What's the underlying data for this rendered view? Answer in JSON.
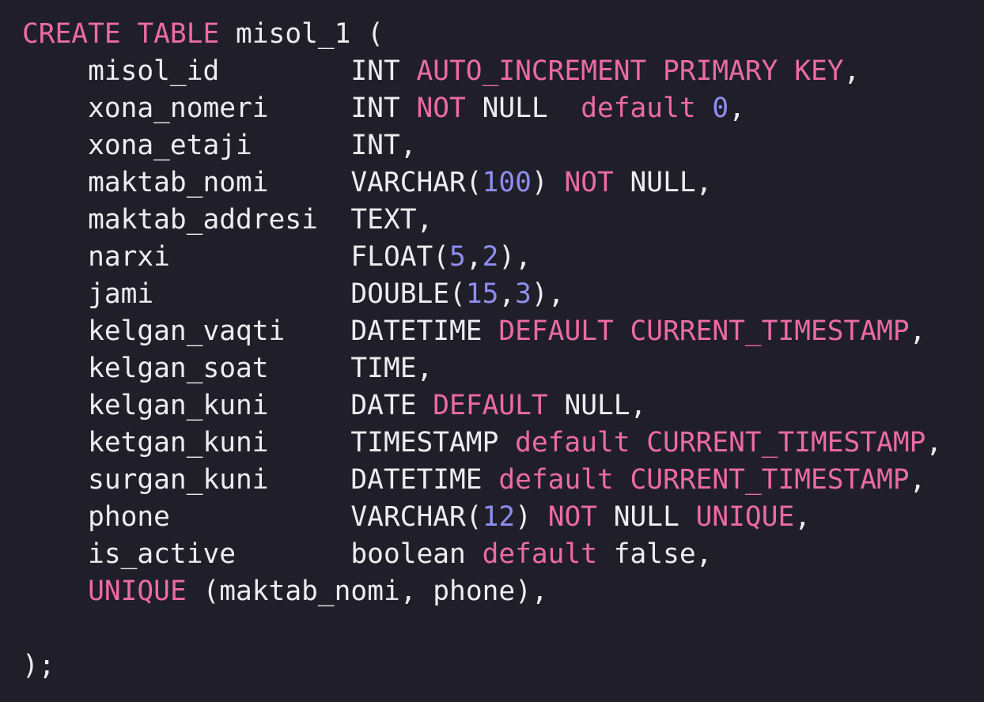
{
  "colors": {
    "background": "#201f29",
    "text": "#ececf1",
    "keyword": "#ec6aa6",
    "number": "#8f8df0"
  },
  "lines": [
    {
      "tokens": [
        {
          "t": "CREATE TABLE",
          "k": "kw"
        },
        {
          "t": " misol_1 (",
          "k": "pl"
        }
      ]
    },
    {
      "tokens": [
        {
          "t": "    misol_id        INT ",
          "k": "pl"
        },
        {
          "t": "AUTO_INCREMENT PRIMARY KEY",
          "k": "kw"
        },
        {
          "t": ",",
          "k": "pl"
        }
      ]
    },
    {
      "tokens": [
        {
          "t": "    xona_nomeri     INT ",
          "k": "pl"
        },
        {
          "t": "NOT",
          "k": "kw"
        },
        {
          "t": " NULL  ",
          "k": "pl"
        },
        {
          "t": "default",
          "k": "kw"
        },
        {
          "t": " ",
          "k": "pl"
        },
        {
          "t": "0",
          "k": "num"
        },
        {
          "t": ",",
          "k": "pl"
        }
      ]
    },
    {
      "tokens": [
        {
          "t": "    xona_etaji      INT,",
          "k": "pl"
        }
      ]
    },
    {
      "tokens": [
        {
          "t": "    maktab_nomi     VARCHAR(",
          "k": "pl"
        },
        {
          "t": "100",
          "k": "num"
        },
        {
          "t": ") ",
          "k": "pl"
        },
        {
          "t": "NOT",
          "k": "kw"
        },
        {
          "t": " NULL,",
          "k": "pl"
        }
      ]
    },
    {
      "tokens": [
        {
          "t": "    maktab_addresi  TEXT,",
          "k": "pl"
        }
      ]
    },
    {
      "tokens": [
        {
          "t": "    narxi           FLOAT(",
          "k": "pl"
        },
        {
          "t": "5",
          "k": "num"
        },
        {
          "t": ",",
          "k": "pl"
        },
        {
          "t": "2",
          "k": "num"
        },
        {
          "t": "),",
          "k": "pl"
        }
      ]
    },
    {
      "tokens": [
        {
          "t": "    jami            DOUBLE(",
          "k": "pl"
        },
        {
          "t": "15",
          "k": "num"
        },
        {
          "t": ",",
          "k": "pl"
        },
        {
          "t": "3",
          "k": "num"
        },
        {
          "t": "),",
          "k": "pl"
        }
      ]
    },
    {
      "tokens": [
        {
          "t": "    kelgan_vaqti    DATETIME ",
          "k": "pl"
        },
        {
          "t": "DEFAULT CURRENT_TIMESTAMP",
          "k": "kw"
        },
        {
          "t": ",",
          "k": "pl"
        }
      ]
    },
    {
      "tokens": [
        {
          "t": "    kelgan_soat     TIME,",
          "k": "pl"
        }
      ]
    },
    {
      "tokens": [
        {
          "t": "    kelgan_kuni     DATE ",
          "k": "pl"
        },
        {
          "t": "DEFAULT",
          "k": "kw"
        },
        {
          "t": " NULL,",
          "k": "pl"
        }
      ]
    },
    {
      "tokens": [
        {
          "t": "    ketgan_kuni     TIMESTAMP ",
          "k": "pl"
        },
        {
          "t": "default CURRENT_TIMESTAMP",
          "k": "kw"
        },
        {
          "t": ",",
          "k": "pl"
        }
      ]
    },
    {
      "tokens": [
        {
          "t": "    surgan_kuni     DATETIME ",
          "k": "pl"
        },
        {
          "t": "default CURRENT_TIMESTAMP",
          "k": "kw"
        },
        {
          "t": ",",
          "k": "pl"
        }
      ]
    },
    {
      "tokens": [
        {
          "t": "    phone           VARCHAR(",
          "k": "pl"
        },
        {
          "t": "12",
          "k": "num"
        },
        {
          "t": ") ",
          "k": "pl"
        },
        {
          "t": "NOT",
          "k": "kw"
        },
        {
          "t": " NULL ",
          "k": "pl"
        },
        {
          "t": "UNIQUE",
          "k": "kw"
        },
        {
          "t": ",",
          "k": "pl"
        }
      ]
    },
    {
      "tokens": [
        {
          "t": "    is_active       boolean ",
          "k": "pl"
        },
        {
          "t": "default",
          "k": "kw"
        },
        {
          "t": " false,",
          "k": "pl"
        }
      ]
    },
    {
      "tokens": [
        {
          "t": "    ",
          "k": "pl"
        },
        {
          "t": "UNIQUE",
          "k": "kw"
        },
        {
          "t": " (maktab_nomi, phone),",
          "k": "pl"
        }
      ]
    },
    {
      "tokens": [
        {
          "t": "",
          "k": "pl"
        }
      ]
    },
    {
      "tokens": [
        {
          "t": ");",
          "k": "pl"
        }
      ]
    }
  ]
}
